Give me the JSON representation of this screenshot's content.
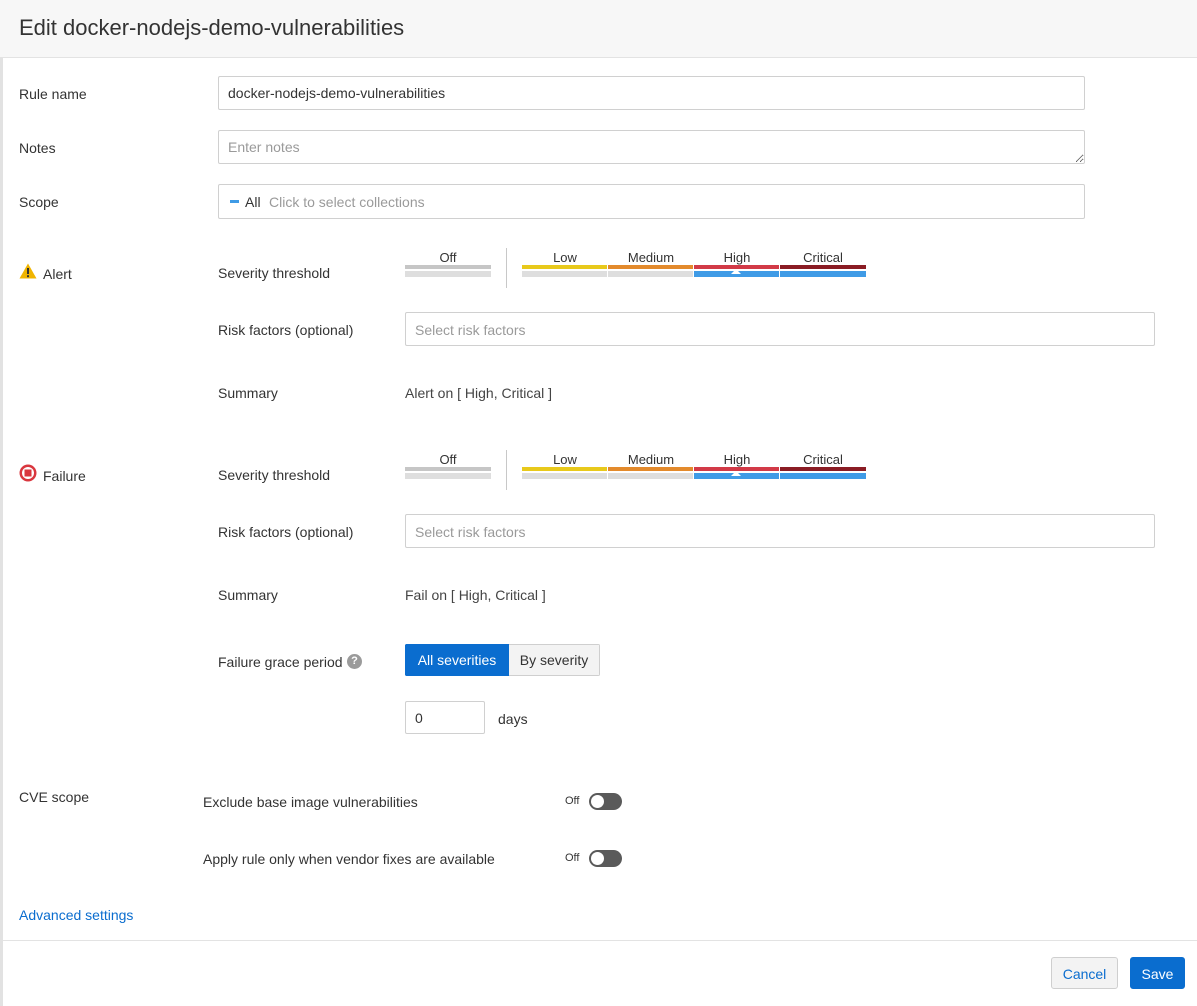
{
  "header": {
    "title": "Edit docker-nodejs-demo-vulnerabilities"
  },
  "form": {
    "rule_name": {
      "label": "Rule name",
      "value": "docker-nodejs-demo-vulnerabilities"
    },
    "notes": {
      "label": "Notes",
      "placeholder": "Enter notes"
    },
    "scope": {
      "label": "Scope",
      "chip": "All",
      "placeholder": "Click to select collections"
    }
  },
  "severity_levels": {
    "off": "Off",
    "low": "Low",
    "medium": "Medium",
    "high": "High",
    "critical": "Critical"
  },
  "alert": {
    "title": "Alert",
    "severity_label": "Severity threshold",
    "selected_threshold": "High",
    "risk_label": "Risk factors (optional)",
    "risk_placeholder": "Select risk factors",
    "summary_label": "Summary",
    "summary_value": "Alert on [ High, Critical ]"
  },
  "failure": {
    "title": "Failure",
    "severity_label": "Severity threshold",
    "selected_threshold": "High",
    "risk_label": "Risk factors (optional)",
    "risk_placeholder": "Select risk factors",
    "summary_label": "Summary",
    "summary_value": "Fail on [ High, Critical ]",
    "grace_label": "Failure grace period",
    "help_icon": "?",
    "grace_options": [
      "All severities",
      "By severity"
    ],
    "grace_selected": "All severities",
    "grace_days_value": "0",
    "days_label": "days"
  },
  "cve_scope": {
    "label": "CVE scope",
    "exclude_base": {
      "label": "Exclude base image vulnerabilities",
      "state": "Off"
    },
    "vendor_fixes": {
      "label": "Apply rule only when vendor fixes are available",
      "state": "Off"
    }
  },
  "advanced_link": "Advanced settings",
  "footer": {
    "cancel": "Cancel",
    "save": "Save"
  },
  "colors": {
    "low": "#e8c91b",
    "medium": "#e38a2c",
    "high": "#d23a47",
    "critical": "#8a1c24",
    "selected": "#3f9be6",
    "primary": "#0a6dcf",
    "warning_icon": "#f0b400",
    "failure_icon": "#d9363e"
  }
}
